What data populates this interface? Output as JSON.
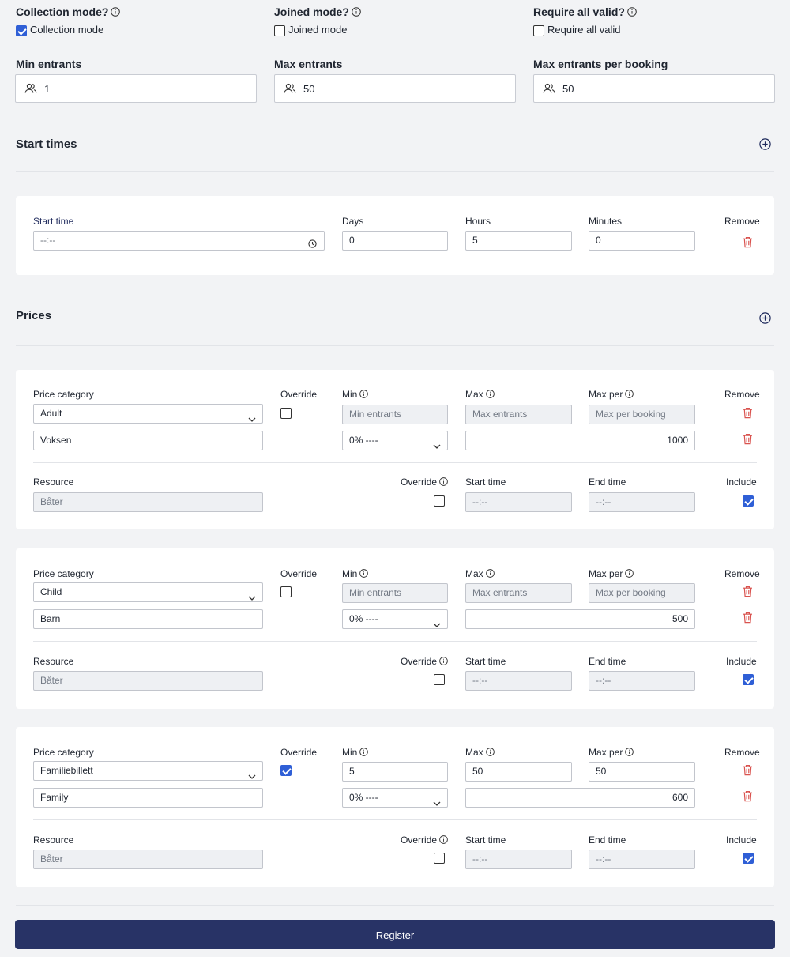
{
  "options": [
    {
      "label": "Collection mode?",
      "checkbox_label": "Collection mode",
      "checked": true
    },
    {
      "label": "Joined mode?",
      "checkbox_label": "Joined mode",
      "checked": false
    },
    {
      "label": "Require all valid?",
      "checkbox_label": "Require all valid",
      "checked": false
    }
  ],
  "entrants": [
    {
      "label": "Min entrants",
      "value": "1"
    },
    {
      "label": "Max entrants",
      "value": "50"
    },
    {
      "label": "Max entrants per booking",
      "value": "50"
    }
  ],
  "start_times": {
    "title": "Start times",
    "headers": {
      "start_time": "Start time",
      "days": "Days",
      "hours": "Hours",
      "minutes": "Minutes",
      "remove": "Remove"
    },
    "rows": [
      {
        "start_time": "--:--",
        "days": "0",
        "hours": "5",
        "minutes": "0"
      }
    ]
  },
  "prices": {
    "title": "Prices",
    "headers": {
      "price_category": "Price category",
      "override": "Override",
      "min": "Min",
      "max": "Max",
      "max_per": "Max per",
      "remove": "Remove",
      "resource": "Resource",
      "start_time": "Start time",
      "end_time": "End time",
      "include": "Include"
    },
    "placeholders": {
      "min": "Min entrants",
      "max": "Max entrants",
      "max_per": "Max per booking"
    },
    "items": [
      {
        "category": "Adult",
        "name": "Voksen",
        "override": false,
        "min": "",
        "max": "",
        "max_per": "",
        "vat": "0% ----",
        "price": "1000",
        "resource": "Båter",
        "resource_override": false,
        "start_time": "--:--",
        "end_time": "--:--",
        "include": true
      },
      {
        "category": "Child",
        "name": "Barn",
        "override": false,
        "min": "",
        "max": "",
        "max_per": "",
        "vat": "0% ----",
        "price": "500",
        "resource": "Båter",
        "resource_override": false,
        "start_time": "--:--",
        "end_time": "--:--",
        "include": true
      },
      {
        "category": "Familiebillett",
        "name": "Family",
        "override": true,
        "min": "5",
        "max": "50",
        "max_per": "50",
        "vat": "0% ----",
        "price": "600",
        "resource": "Båter",
        "resource_override": false,
        "start_time": "--:--",
        "end_time": "--:--",
        "include": true
      }
    ]
  },
  "register_label": "Register",
  "colors": {
    "primary": "#283366",
    "checkbox": "#2f5fd6",
    "danger": "#d9534f"
  }
}
